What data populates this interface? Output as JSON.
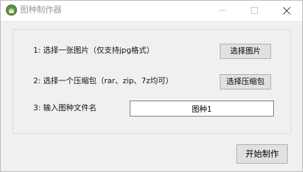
{
  "window": {
    "title": "图种制作器"
  },
  "form": {
    "step1_label": "1: 选择一张图片（仅支持jpg格式）",
    "step1_button": "选择图片",
    "step2_label": "2: 选择一个压缩包（rar、zip、7z均可）",
    "step2_button": "选择压缩包",
    "step3_label": "3: 输入图种文件名",
    "filename_value": "图种1"
  },
  "footer": {
    "make_button": "开始制作"
  }
}
